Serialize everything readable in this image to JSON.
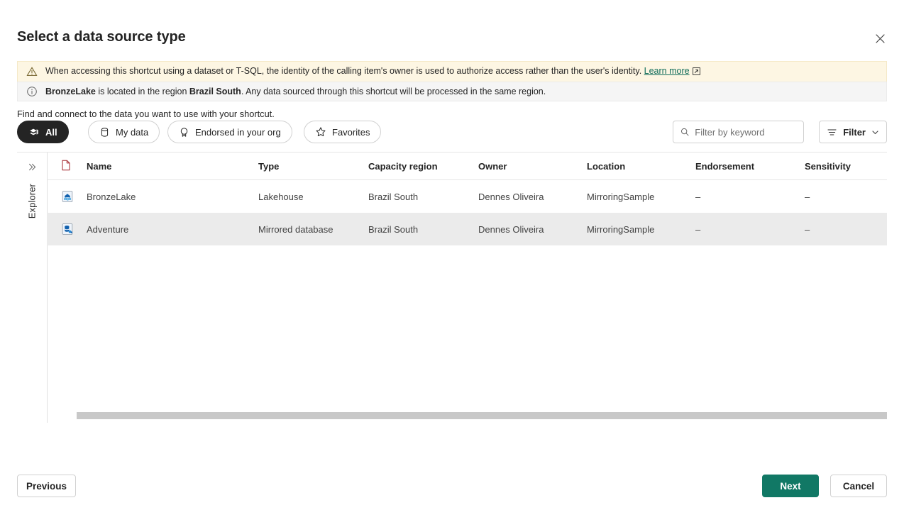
{
  "dialog": {
    "title": "Select a data source type",
    "close_label": "Close"
  },
  "banners": {
    "warning": {
      "icon": "warning-triangle-icon",
      "text_before": "When accessing this shortcut using a dataset or T-SQL, the identity of the calling item's owner is used to authorize access rather than the user's identity.",
      "link_label": "Learn more",
      "link_icon": "open-in-new-icon"
    },
    "info": {
      "icon": "info-circle-icon",
      "part1": "",
      "bold1": "BronzeLake",
      "part2": " is located in the region ",
      "bold2": "Brazil South",
      "part3": ". Any data sourced through this shortcut will be processed in the same region."
    }
  },
  "subtitle": "Find and connect to the data you want to use with your shortcut.",
  "tabs": [
    {
      "label": "All",
      "icon": "layers-icon",
      "active": true
    },
    {
      "label": "My data",
      "icon": "database-icon",
      "active": false
    },
    {
      "label": "Endorsed in your org",
      "icon": "badge-icon",
      "active": false
    },
    {
      "label": "Favorites",
      "icon": "star-icon",
      "active": false
    }
  ],
  "search": {
    "placeholder": "Filter by keyword",
    "value": "",
    "icon": "search-icon"
  },
  "filter_button": {
    "label": "Filter",
    "icon": "filter-lines-icon",
    "chevron": "chevron-down-icon"
  },
  "explorer_rail": {
    "label": "Explorer",
    "chevron": "chevron-double-right-icon"
  },
  "table": {
    "columns": [
      {
        "key": "icon",
        "label": ""
      },
      {
        "key": "name",
        "label": "Name"
      },
      {
        "key": "type",
        "label": "Type"
      },
      {
        "key": "region",
        "label": "Capacity region"
      },
      {
        "key": "owner",
        "label": "Owner"
      },
      {
        "key": "location",
        "label": "Location"
      },
      {
        "key": "endorsement",
        "label": "Endorsement"
      },
      {
        "key": "sensitivity",
        "label": "Sensitivity"
      }
    ],
    "header_icon": "document-icon",
    "rows": [
      {
        "icon": "lakehouse-icon",
        "name": "BronzeLake",
        "type": "Lakehouse",
        "region": "Brazil South",
        "owner": "Dennes Oliveira",
        "location": "MirroringSample",
        "endorsement": "–",
        "sensitivity": "–",
        "selected": false
      },
      {
        "icon": "mirrored-database-icon",
        "name": "Adventure",
        "type": "Mirrored database",
        "region": "Brazil South",
        "owner": "Dennes Oliveira",
        "location": "MirroringSample",
        "endorsement": "–",
        "sensitivity": "–",
        "selected": true
      }
    ]
  },
  "footer": {
    "previous_label": "Previous",
    "next_label": "Next",
    "cancel_label": "Cancel"
  },
  "colors": {
    "accent_green": "#117865",
    "link_green": "#0e6b58",
    "warning_bg": "#fdf6e3",
    "info_bg": "#f5f5f5",
    "row_selected_bg": "#ebebeb",
    "pill_active_bg": "#242424",
    "item_icon_blue": "#0f6cbd"
  }
}
